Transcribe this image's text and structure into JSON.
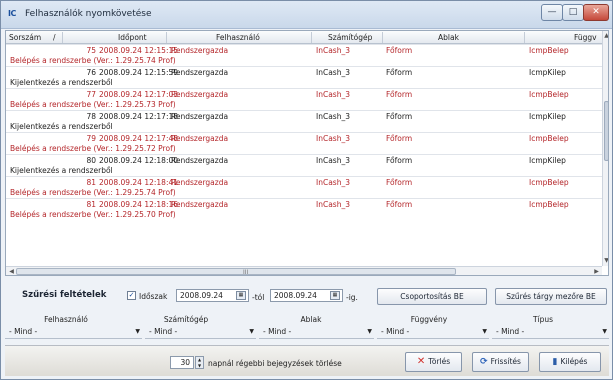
{
  "window": {
    "title": "Felhasználók nyomkövetése",
    "app_icon": "IC",
    "minimize": "—",
    "maximize": "□",
    "close": "✕"
  },
  "grid": {
    "columns": [
      "Sorszám",
      "Időpont",
      "Felhasználó",
      "Számítógép",
      "Ablak",
      "Függv"
    ],
    "sort_indicator": "/",
    "records": [
      {
        "id": "75",
        "time": "2008.09.24 12:15:15",
        "user": "Rendszergazda",
        "computer": "InCash_3",
        "window": "Főform",
        "func": "IcmpBelep",
        "desc": "Belépés a rendszerbe (Ver.: 1.29.25.74 Prof)",
        "red": true
      },
      {
        "id": "76",
        "time": "2008.09.24 12:15:59",
        "user": "Rendszergazda",
        "computer": "InCash_3",
        "window": "Főform",
        "func": "IcmpKilep",
        "desc": "Kijelentkezés a rendszerből",
        "red": false
      },
      {
        "id": "77",
        "time": "2008.09.24 12:17:03",
        "user": "Rendszergazda",
        "computer": "InCash_3",
        "window": "Főform",
        "func": "IcmpBelep",
        "desc": "Belépés a rendszerbe (Ver.: 1.29.25.73 Prof)",
        "red": true
      },
      {
        "id": "78",
        "time": "2008.09.24 12:17:18",
        "user": "Rendszergazda",
        "computer": "InCash_3",
        "window": "Főform",
        "func": "IcmpKilep",
        "desc": "Kijelentkezés a rendszerből",
        "red": false
      },
      {
        "id": "79",
        "time": "2008.09.24 12:17:48",
        "user": "Rendszergazda",
        "computer": "InCash_3",
        "window": "Főform",
        "func": "IcmpBelep",
        "desc": "Belépés a rendszerbe (Ver.: 1.29.25.72 Prof)",
        "red": true
      },
      {
        "id": "80",
        "time": "2008.09.24 12:18:00",
        "user": "Rendszergazda",
        "computer": "InCash_3",
        "window": "Főform",
        "func": "IcmpKilep",
        "desc": "Kijelentkezés a rendszerből",
        "red": false
      },
      {
        "id": "81",
        "time": "2008.09.24 12:18:41",
        "user": "Rendszergazda",
        "computer": "InCash_3",
        "window": "Főform",
        "func": "IcmpBelep",
        "desc": "Belépés a rendszerbe (Ver.: 1.29.25.74 Prof)",
        "red": true
      },
      {
        "id": "81",
        "time": "2008.09.24 12:18:16",
        "user": "Rendszergazda",
        "computer": "InCash_3",
        "window": "Főform",
        "func": "IcmpBelep",
        "desc": "Belépés a rendszerbe (Ver.: 1.29.25.70 Prof)",
        "red": true
      }
    ],
    "hscroll_grip": "III"
  },
  "filter": {
    "title": "Szűrési feltételek",
    "period_checked": true,
    "period_label": "Időszak",
    "date_from": "2008.09.24",
    "from_suffix": "-tól",
    "date_to": "2008.09.24",
    "to_suffix": "-ig.",
    "group_button": "Csoportosítás BE",
    "subject_filter_button": "Szűrés tárgy mezőre BE",
    "columns": [
      {
        "label": "Felhasználó",
        "value": "- Mind -"
      },
      {
        "label": "Számítógép",
        "value": "- Mind -"
      },
      {
        "label": "Ablak",
        "value": "- Mind -"
      },
      {
        "label": "Függvény",
        "value": "- Mind -"
      },
      {
        "label": "Típus",
        "value": "- Mind -"
      }
    ]
  },
  "bottom": {
    "days_value": "30",
    "days_label": "napnál régebbi bejegyzések törlése",
    "delete_button": "Törlés",
    "refresh_button": "Frissítés",
    "exit_button": "Kilépés"
  },
  "colors": {
    "red_text": "#b4262a",
    "accent_blue": "#2d63b9"
  }
}
